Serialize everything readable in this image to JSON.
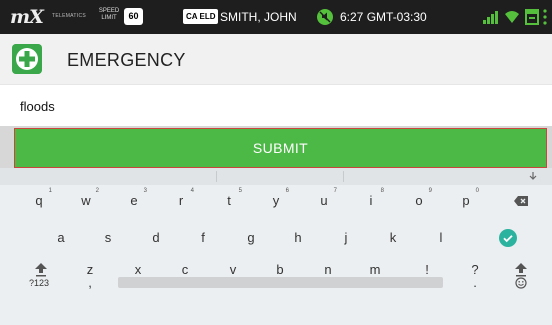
{
  "status": {
    "logo": "mX",
    "telematics": "TELEMATICS",
    "speed_label_1": "SPEED",
    "speed_label_2": "LIMIT",
    "speed_limit": "60",
    "eld": "CA ELD",
    "driver_name": "SMITH, JOHN",
    "time": "6:27 GMT-03:30",
    "icons": [
      "mute-icon",
      "signal-icon",
      "wifi-icon",
      "calendar-icon",
      "overflow-menu-icon"
    ]
  },
  "app": {
    "title": "EMERGENCY",
    "icon": "plus-icon",
    "accent": "#3aa84a"
  },
  "form": {
    "input_value": "floods",
    "submit_label": "SUBMIT",
    "submit_color": "#4cb846",
    "submit_border": "#c9463c"
  },
  "keyboard": {
    "row1": [
      {
        "key": "q",
        "hint": "1"
      },
      {
        "key": "w",
        "hint": "2"
      },
      {
        "key": "e",
        "hint": "3"
      },
      {
        "key": "r",
        "hint": "4"
      },
      {
        "key": "t",
        "hint": "5"
      },
      {
        "key": "y",
        "hint": "6"
      },
      {
        "key": "u",
        "hint": "7"
      },
      {
        "key": "i",
        "hint": "8"
      },
      {
        "key": "o",
        "hint": "9"
      },
      {
        "key": "p",
        "hint": "0"
      }
    ],
    "row2": [
      "a",
      "s",
      "d",
      "f",
      "g",
      "h",
      "j",
      "k",
      "l"
    ],
    "row3": [
      "z",
      "x",
      "c",
      "v",
      "b",
      "n",
      "m",
      "!",
      "?"
    ],
    "symbols_label": "?123",
    "comma": ",",
    "period": ".",
    "special_keys": [
      "backspace-icon",
      "done-check-icon",
      "shift-icon",
      "emoji-icon",
      "collapse-keyboard-icon"
    ]
  }
}
